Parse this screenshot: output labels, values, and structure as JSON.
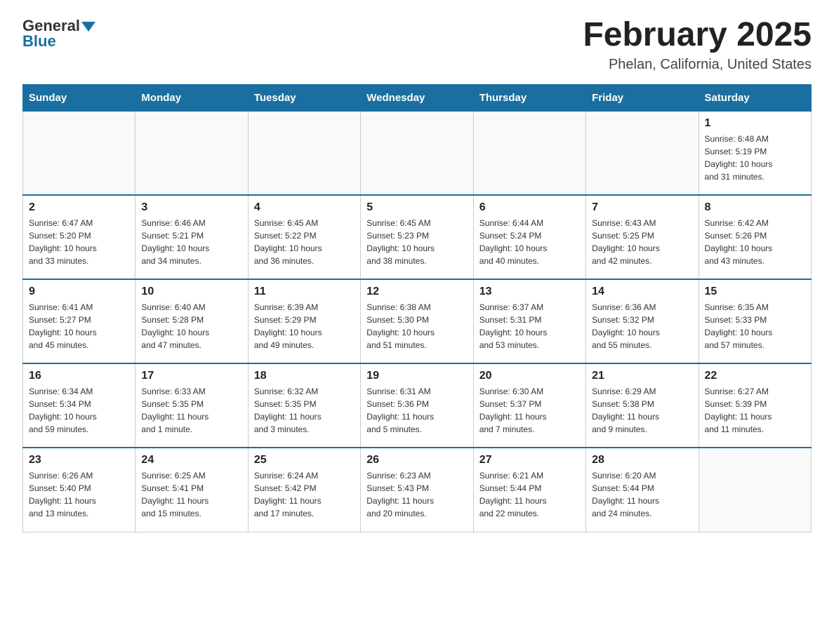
{
  "header": {
    "logo_general": "General",
    "logo_blue": "Blue",
    "month_title": "February 2025",
    "location": "Phelan, California, United States"
  },
  "weekdays": [
    "Sunday",
    "Monday",
    "Tuesday",
    "Wednesday",
    "Thursday",
    "Friday",
    "Saturday"
  ],
  "weeks": [
    [
      {
        "day": "",
        "info": ""
      },
      {
        "day": "",
        "info": ""
      },
      {
        "day": "",
        "info": ""
      },
      {
        "day": "",
        "info": ""
      },
      {
        "day": "",
        "info": ""
      },
      {
        "day": "",
        "info": ""
      },
      {
        "day": "1",
        "info": "Sunrise: 6:48 AM\nSunset: 5:19 PM\nDaylight: 10 hours\nand 31 minutes."
      }
    ],
    [
      {
        "day": "2",
        "info": "Sunrise: 6:47 AM\nSunset: 5:20 PM\nDaylight: 10 hours\nand 33 minutes."
      },
      {
        "day": "3",
        "info": "Sunrise: 6:46 AM\nSunset: 5:21 PM\nDaylight: 10 hours\nand 34 minutes."
      },
      {
        "day": "4",
        "info": "Sunrise: 6:45 AM\nSunset: 5:22 PM\nDaylight: 10 hours\nand 36 minutes."
      },
      {
        "day": "5",
        "info": "Sunrise: 6:45 AM\nSunset: 5:23 PM\nDaylight: 10 hours\nand 38 minutes."
      },
      {
        "day": "6",
        "info": "Sunrise: 6:44 AM\nSunset: 5:24 PM\nDaylight: 10 hours\nand 40 minutes."
      },
      {
        "day": "7",
        "info": "Sunrise: 6:43 AM\nSunset: 5:25 PM\nDaylight: 10 hours\nand 42 minutes."
      },
      {
        "day": "8",
        "info": "Sunrise: 6:42 AM\nSunset: 5:26 PM\nDaylight: 10 hours\nand 43 minutes."
      }
    ],
    [
      {
        "day": "9",
        "info": "Sunrise: 6:41 AM\nSunset: 5:27 PM\nDaylight: 10 hours\nand 45 minutes."
      },
      {
        "day": "10",
        "info": "Sunrise: 6:40 AM\nSunset: 5:28 PM\nDaylight: 10 hours\nand 47 minutes."
      },
      {
        "day": "11",
        "info": "Sunrise: 6:39 AM\nSunset: 5:29 PM\nDaylight: 10 hours\nand 49 minutes."
      },
      {
        "day": "12",
        "info": "Sunrise: 6:38 AM\nSunset: 5:30 PM\nDaylight: 10 hours\nand 51 minutes."
      },
      {
        "day": "13",
        "info": "Sunrise: 6:37 AM\nSunset: 5:31 PM\nDaylight: 10 hours\nand 53 minutes."
      },
      {
        "day": "14",
        "info": "Sunrise: 6:36 AM\nSunset: 5:32 PM\nDaylight: 10 hours\nand 55 minutes."
      },
      {
        "day": "15",
        "info": "Sunrise: 6:35 AM\nSunset: 5:33 PM\nDaylight: 10 hours\nand 57 minutes."
      }
    ],
    [
      {
        "day": "16",
        "info": "Sunrise: 6:34 AM\nSunset: 5:34 PM\nDaylight: 10 hours\nand 59 minutes."
      },
      {
        "day": "17",
        "info": "Sunrise: 6:33 AM\nSunset: 5:35 PM\nDaylight: 11 hours\nand 1 minute."
      },
      {
        "day": "18",
        "info": "Sunrise: 6:32 AM\nSunset: 5:35 PM\nDaylight: 11 hours\nand 3 minutes."
      },
      {
        "day": "19",
        "info": "Sunrise: 6:31 AM\nSunset: 5:36 PM\nDaylight: 11 hours\nand 5 minutes."
      },
      {
        "day": "20",
        "info": "Sunrise: 6:30 AM\nSunset: 5:37 PM\nDaylight: 11 hours\nand 7 minutes."
      },
      {
        "day": "21",
        "info": "Sunrise: 6:29 AM\nSunset: 5:38 PM\nDaylight: 11 hours\nand 9 minutes."
      },
      {
        "day": "22",
        "info": "Sunrise: 6:27 AM\nSunset: 5:39 PM\nDaylight: 11 hours\nand 11 minutes."
      }
    ],
    [
      {
        "day": "23",
        "info": "Sunrise: 6:26 AM\nSunset: 5:40 PM\nDaylight: 11 hours\nand 13 minutes."
      },
      {
        "day": "24",
        "info": "Sunrise: 6:25 AM\nSunset: 5:41 PM\nDaylight: 11 hours\nand 15 minutes."
      },
      {
        "day": "25",
        "info": "Sunrise: 6:24 AM\nSunset: 5:42 PM\nDaylight: 11 hours\nand 17 minutes."
      },
      {
        "day": "26",
        "info": "Sunrise: 6:23 AM\nSunset: 5:43 PM\nDaylight: 11 hours\nand 20 minutes."
      },
      {
        "day": "27",
        "info": "Sunrise: 6:21 AM\nSunset: 5:44 PM\nDaylight: 11 hours\nand 22 minutes."
      },
      {
        "day": "28",
        "info": "Sunrise: 6:20 AM\nSunset: 5:44 PM\nDaylight: 11 hours\nand 24 minutes."
      },
      {
        "day": "",
        "info": ""
      }
    ]
  ]
}
